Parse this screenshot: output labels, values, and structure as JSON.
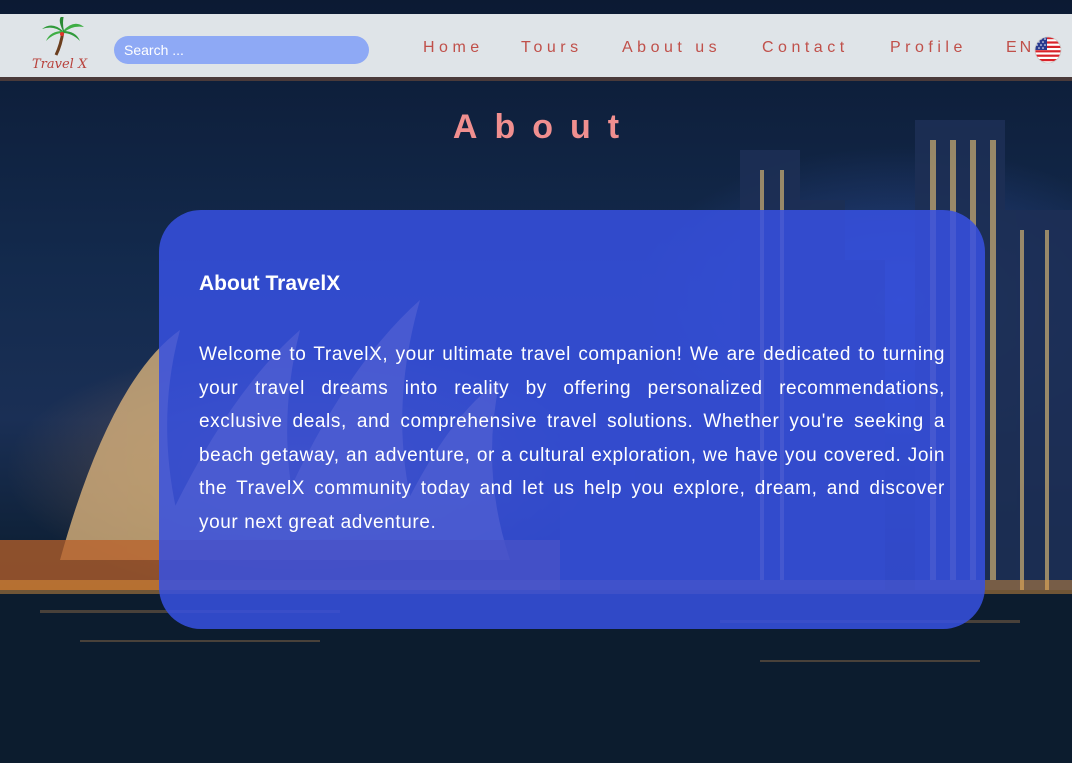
{
  "header": {
    "logo_text": "Travel X",
    "search": {
      "placeholder": "Search ..."
    },
    "nav": [
      {
        "label": "Home"
      },
      {
        "label": "Tours"
      },
      {
        "label": "About us"
      },
      {
        "label": "Contact"
      },
      {
        "label": "Profile"
      }
    ],
    "language": "EN",
    "language_flag_icon": "us-flag-icon"
  },
  "page": {
    "title": "About"
  },
  "about_card": {
    "heading": "About TravelX",
    "body": "Welcome to TravelX, your ultimate travel companion! We are dedicated to turning your travel dreams into reality by offering personalized recommendations, exclusive deals, and comprehensive travel solutions. Whether you're seeking a beach getaway, an adventure, or a cultural exploration, we have you covered. Join the TravelX community today and let us help you explore, dream, and discover your next great adventure."
  },
  "colors": {
    "nav_background": "#dfe4e8",
    "nav_text": "#c0504a",
    "search_background": "#8ea9f5",
    "title": "#f08f8f",
    "card_background": "#3750e1"
  }
}
